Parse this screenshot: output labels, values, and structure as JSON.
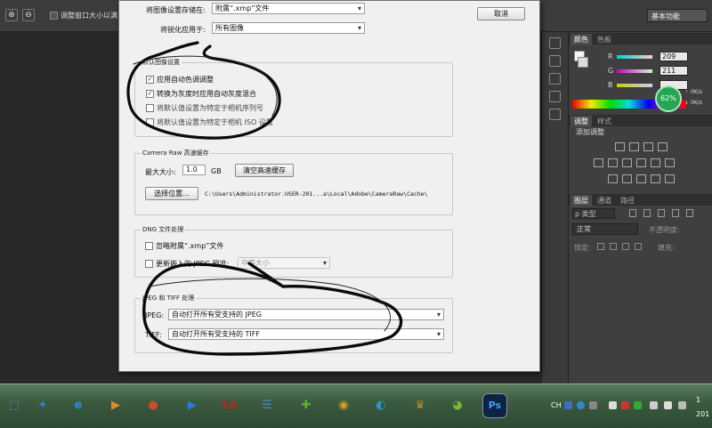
{
  "toolbar": {
    "fit_window_label": "调整窗口大小以满",
    "workspace": "基本功能"
  },
  "panels": {
    "color_tabs": [
      "颜色",
      "色板"
    ],
    "channels": [
      {
        "label": "R",
        "value": "209"
      },
      {
        "label": "G",
        "value": "211"
      },
      {
        "label": "B",
        "value": ""
      }
    ],
    "badge": "62%",
    "edge_notes": [
      "↑",
      "0K/s",
      "↓",
      "0K/s"
    ],
    "adjust_tabs": [
      "调整",
      "样式"
    ],
    "adjust_title": "添加调整",
    "layer_tabs": [
      "图层",
      "通道",
      "路径"
    ],
    "layer_filter": "ρ 类型",
    "blend_mode": "正常",
    "opacity_label": "不透明度:",
    "lock_label": "锁定:",
    "fill_label": "填充:"
  },
  "dialog": {
    "save_settings_label": "将图像设置存储在:",
    "save_settings_value": "附属“.xmp”文件",
    "sharpen_label": "将锐化应用于:",
    "sharpen_value": "所有图像",
    "cancel_label": "取消",
    "defaults_title": "默认图像设置",
    "defaults_options": [
      {
        "label": "应用自动色调调整",
        "checked": "✓"
      },
      {
        "label": "转换为灰度时应用自动灰度混合",
        "checked": "✓"
      },
      {
        "label": "将默认值设置为特定于相机序列号",
        "checked": ""
      },
      {
        "label": "将默认值设置为特定于相机 ISO 设置",
        "checked": ""
      }
    ],
    "cache_title": "Camera Raw 高速缓存",
    "max_size_label": "最大大小:",
    "max_size_value": "1.0",
    "max_size_unit": "GB",
    "purge_label": "清空高速缓存",
    "location_button": "选择位置...",
    "location_path": "C:\\Users\\Administrator.USER-201...a\\Local\\Adobe\\CameraRaw\\Cache\\",
    "dng_title": "DNG 文件处理",
    "dng_ignore_label": "忽略附属“.xmp”文件",
    "dng_update_label": "更新嵌入的 JPEG 预览:",
    "dng_preview_value": "中等大小",
    "jpeg_tiff_title": "JPEG 和 TIFF 处理",
    "jpeg_label": "JPEG:",
    "jpeg_value": "自动打开所有受支持的 JPEG",
    "tiff_label": "TIFF:",
    "tiff_value": "自动打开所有受支持的 TIFF"
  },
  "taskbar": {
    "icons": [
      {
        "name": "network-app",
        "glyph": "⬚",
        "color": "#7a8fa8"
      },
      {
        "name": "bird-app",
        "glyph": "✦",
        "color": "#3a7fd6"
      },
      {
        "name": "ie-browser",
        "glyph": "e",
        "color": "#2a8be0"
      },
      {
        "name": "media-player",
        "glyph": "▶",
        "color": "#e08a2a"
      },
      {
        "name": "ball-app",
        "glyph": "●",
        "color": "#d04a2a"
      },
      {
        "name": "video-player",
        "glyph": "▶",
        "color": "#2a7ad8"
      },
      {
        "name": "le-app",
        "glyph": "Le",
        "color": "#c8201c"
      },
      {
        "name": "circle-app",
        "glyph": "☰",
        "color": "#4a8ac8"
      },
      {
        "name": "plus-app",
        "glyph": "✚",
        "color": "#5ab82a"
      },
      {
        "name": "chrome-browser",
        "glyph": "◉",
        "color": "#d8a020"
      },
      {
        "name": "qq-app",
        "glyph": "◐",
        "color": "#2a98d8"
      },
      {
        "name": "game-app",
        "glyph": "♛",
        "color": "#b88a2a"
      },
      {
        "name": "chat-app",
        "glyph": "◕",
        "color": "#7ab82a"
      },
      {
        "name": "photoshop",
        "glyph": "Ps",
        "color": "#1c3a6c"
      }
    ],
    "tray_lang": "CH",
    "clock_top": "1",
    "clock_bottom": "201"
  }
}
